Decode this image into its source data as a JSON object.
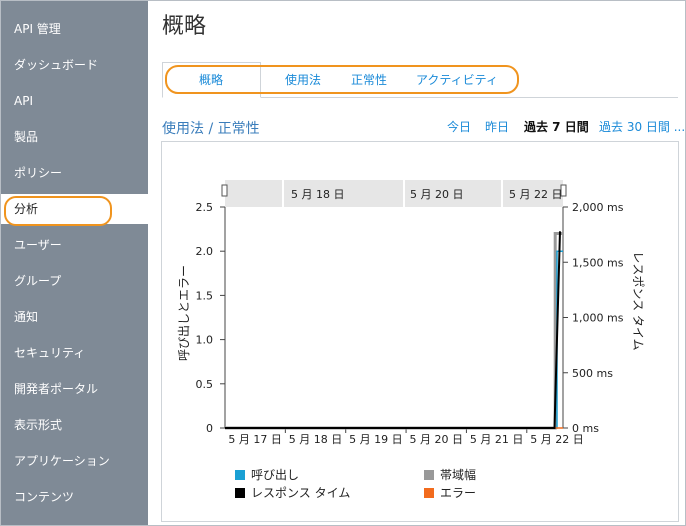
{
  "sidebar": {
    "items": [
      {
        "label": "API 管理"
      },
      {
        "label": "ダッシュボード"
      },
      {
        "label": "API"
      },
      {
        "label": "製品"
      },
      {
        "label": "ポリシー"
      },
      {
        "label": "分析"
      },
      {
        "label": "ユーザー"
      },
      {
        "label": "グループ"
      },
      {
        "label": "通知"
      },
      {
        "label": "セキュリティ"
      },
      {
        "label": "開発者ポータル"
      },
      {
        "label": "表示形式"
      },
      {
        "label": "アプリケーション"
      },
      {
        "label": "コンテンツ"
      }
    ],
    "active_index": 5
  },
  "page": {
    "title": "概略"
  },
  "tabs": [
    {
      "label": "概略"
    },
    {
      "label": "使用法"
    },
    {
      "label": "正常性"
    },
    {
      "label": "アクティビティ"
    }
  ],
  "section": {
    "title": "使用法 / 正常性"
  },
  "ranges": [
    {
      "label": "今日"
    },
    {
      "label": "昨日"
    },
    {
      "label": "過去 7 日間"
    },
    {
      "label": "過去 30 日間 ..."
    }
  ],
  "selected_range_index": 2,
  "colors": {
    "accent": "#1a8ad8",
    "highlight_ring": "#f0941e",
    "sidebar_bg": "#7f8a96",
    "calls": "#1aa0d4",
    "bandwidth": "#999999",
    "response_time": "#000000",
    "errors": "#f26b1d"
  },
  "chart_data": {
    "type": "line",
    "navigator_labels": [
      "5 月 18 日",
      "5 月 20 日",
      "5 月 22 日"
    ],
    "x_tick_labels": [
      "5 月 17 日",
      "5 月 18 日",
      "5 月 19 日",
      "5 月 20 日",
      "5 月 21 日",
      "5 月 22 日"
    ],
    "ylabel_left": "呼び出しとエラー",
    "ylabel_right": "レスポンス タイム",
    "y_left_ticks": [
      "0",
      "0.5",
      "1.0",
      "1.5",
      "2.0",
      "2.5"
    ],
    "y_right_ticks": [
      "0 ms",
      "500 ms",
      "1,000 ms",
      "1,500 ms",
      "2,000 ms"
    ],
    "ylim_left": [
      0,
      2.5
    ],
    "ylim_right": [
      0,
      2000
    ],
    "x_range_days": [
      16.5,
      22.1
    ],
    "series": [
      {
        "name": "呼び出し",
        "axis": "left",
        "x": [
          16.5,
          22.0,
          22.0,
          22.1
        ],
        "values": [
          0,
          0,
          2,
          2
        ]
      },
      {
        "name": "帯域幅",
        "axis": "left",
        "x": [
          16.5,
          21.97,
          21.97,
          22.1
        ],
        "values": [
          0,
          0,
          2.2,
          2.2
        ]
      },
      {
        "name": "レスポンス タイム",
        "axis": "right",
        "x": [
          16.5,
          21.96,
          22.05
        ],
        "values": [
          0,
          0,
          1780
        ]
      },
      {
        "name": "エラー",
        "axis": "left",
        "x": [
          16.5,
          22.1
        ],
        "values": [
          0,
          0
        ]
      }
    ],
    "legend": [
      {
        "label": "呼び出し",
        "color": "#1aa0d4"
      },
      {
        "label": "帯域幅",
        "color": "#999999"
      },
      {
        "label": "レスポンス タイム",
        "color": "#000000"
      },
      {
        "label": "エラー",
        "color": "#f26b1d"
      }
    ],
    "legend_position": "bottom"
  }
}
